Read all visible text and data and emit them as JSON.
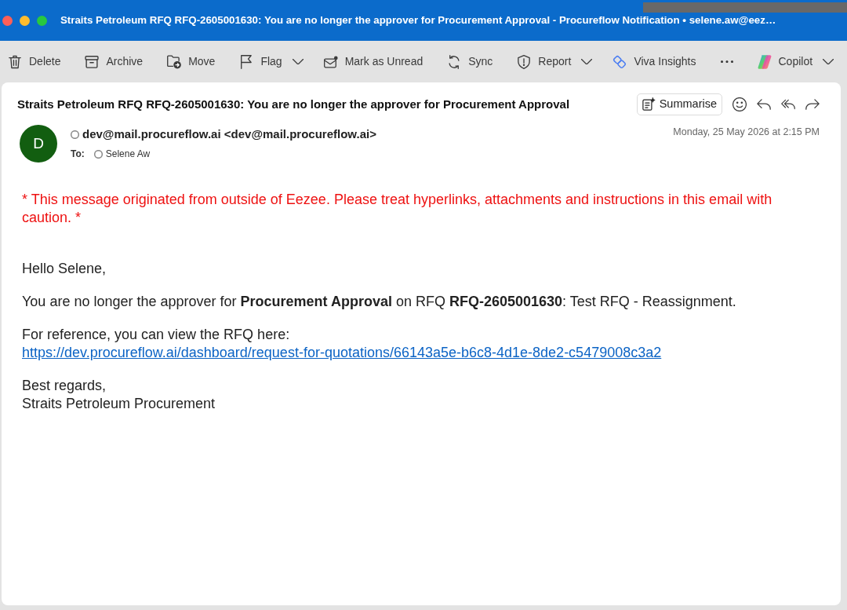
{
  "window": {
    "title": "Straits Petroleum RFQ RFQ-2605001630: You are no longer the approver for Procurement Approval - Procureflow Notification • selene.aw@eez…"
  },
  "toolbar": [
    {
      "kind": "button",
      "label": "Delete"
    },
    {
      "kind": "button",
      "label": "Archive"
    },
    {
      "kind": "button",
      "label": "Move"
    },
    {
      "kind": "dropdown",
      "label": "Flag"
    },
    {
      "kind": "button",
      "label": "Mark as Unread"
    },
    {
      "kind": "button",
      "label": "Sync"
    },
    {
      "kind": "dropdown",
      "label": "Report"
    },
    {
      "kind": "button",
      "label": "Viva Insights"
    },
    {
      "kind": "more"
    },
    {
      "kind": "dropdown",
      "label": "Copilot"
    }
  ],
  "message": {
    "subject": "Straits Petroleum RFQ RFQ-2605001630: You are no longer the approver for Procurement Approval",
    "summarise_button": "Summarise",
    "sender": {
      "initial": "D",
      "address": "dev@mail.procureflow.ai <dev@mail.procureflow.ai>"
    },
    "to": {
      "label": "To:",
      "recipients": [
        "Selene Aw"
      ]
    },
    "date": "Monday, 25 May 2026 at 2:15 PM",
    "warning": "* This message originated from outside of Eezee. Please treat hyperlinks, attachments and instructions in this email with caution. *",
    "body": [
      {
        "kind": "text",
        "text": "Hello Selene,"
      },
      {
        "kind": "text",
        "text": "You are no longer the approver for **Procurement Approval** on RFQ **RFQ-2605001630**: Test RFQ - Reassignment."
      },
      {
        "kind": "link",
        "text": "For reference, you can view the RFQ here:",
        "link": "https://dev.procureflow.ai/dashboard/request-for-quotations/66143a5e-b6c8-4d1e-8de2-c5479008c3a2"
      },
      {
        "kind": "lines",
        "lines": [
          "Best regards,",
          "Straits Petroleum Procurement"
        ]
      }
    ]
  }
}
